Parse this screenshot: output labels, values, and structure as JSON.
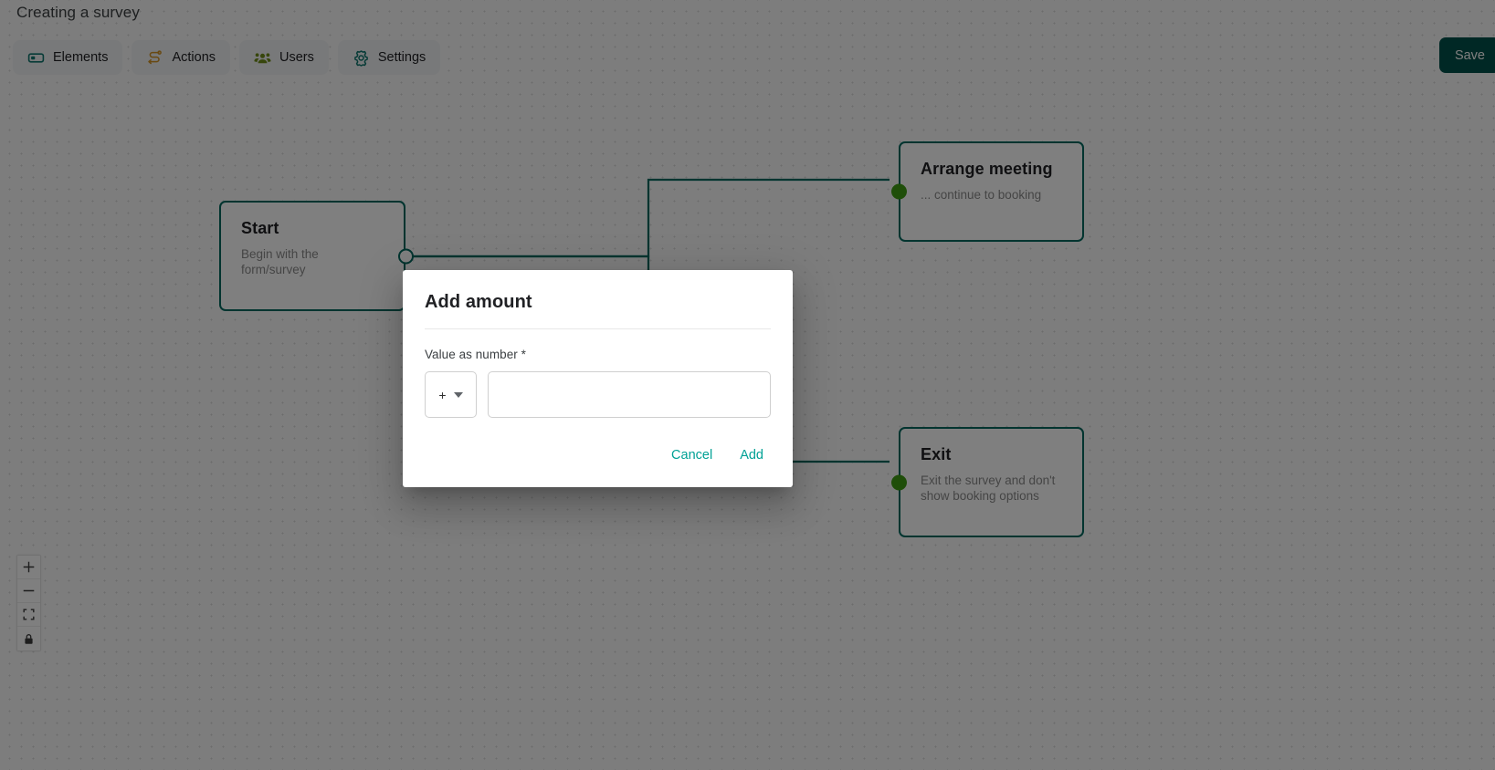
{
  "header": {
    "title": "Creating a survey",
    "save_label": "Save",
    "toolbar": [
      {
        "label": "Elements",
        "icon": "rectangle-element-icon",
        "color": "#0f766e"
      },
      {
        "label": "Actions",
        "icon": "route-actions-icon",
        "color": "#d39324"
      },
      {
        "label": "Users",
        "icon": "users-group-icon",
        "color": "#6f8c18"
      },
      {
        "label": "Settings",
        "icon": "gear-icon",
        "color": "#0f766e"
      }
    ]
  },
  "canvas": {
    "nodes": [
      {
        "id": "start",
        "title": "Start",
        "description": "Begin with the form/survey",
        "handle": "source",
        "handle_color": "#00695f"
      },
      {
        "id": "arrange-meeting",
        "title": "Arrange meeting",
        "description": "... continue to booking",
        "handle": "target",
        "handle_color": "#3f9c12"
      },
      {
        "id": "exit",
        "title": "Exit",
        "description": "Exit the survey and don't show booking options",
        "handle": "target",
        "handle_color": "#3f9c12"
      }
    ],
    "edge_color": "#00695f",
    "controls": [
      {
        "name": "zoom-in",
        "glyph": "+"
      },
      {
        "name": "zoom-out",
        "glyph": "−"
      },
      {
        "name": "fit-view",
        "glyph": "fit"
      },
      {
        "name": "lock",
        "glyph": "lock"
      }
    ]
  },
  "dialog": {
    "title": "Add amount",
    "field_label": "Value as number *",
    "unit_value": "+",
    "input_value": "",
    "input_placeholder": "",
    "cancel_label": "Cancel",
    "add_label": "Add",
    "accent_color": "#00a195"
  }
}
